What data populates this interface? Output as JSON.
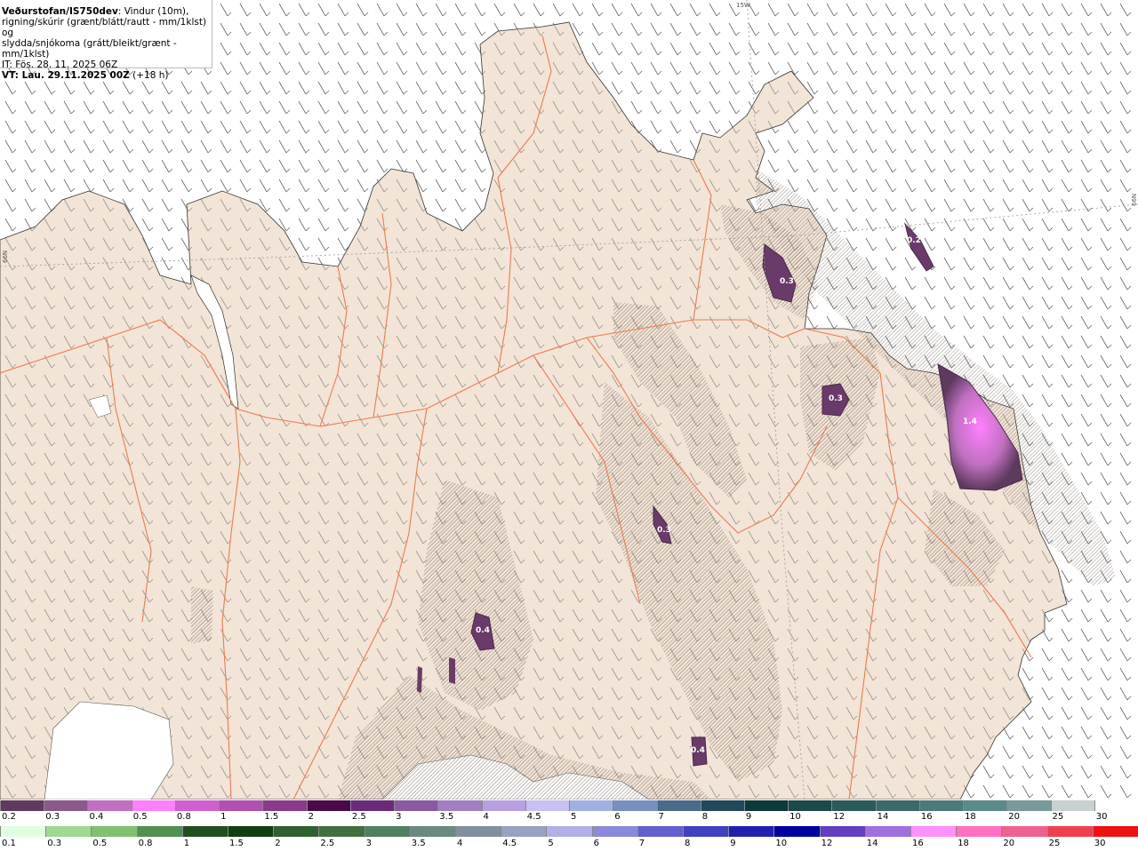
{
  "info": {
    "title_bold": "Veðurstofan/IS750dev",
    "title_rest": ": Vindur (10m),",
    "line2": "rigning/skúrir (grænt/blátt/rautt - mm/1klst) og",
    "line3": "slydda/snjókoma (grátt/bleikt/grænt - mm/1klst)",
    "it": "IT: Fös. 28. 11. 2025 06Z",
    "vt_bold": "VT: Lau. 29.11.2025 00Z",
    "vt_rest": " (+18 h)"
  },
  "grid_labels": {
    "lon_15w": "15W",
    "lat_66n_left": "66N",
    "lat_66n_right": "66N"
  },
  "contour_labels": [
    "0.3",
    "0.3",
    "0.3",
    "1.4",
    "0.4",
    "0.4",
    "0.2"
  ],
  "colors": {
    "land": "#f2e4d6",
    "sea": "#ffffff",
    "roads": "#f07a50",
    "glacier": "#ffffff"
  },
  "legend_snow": {
    "labels": [
      "0.2",
      "0.3",
      "0.4",
      "0.5",
      "0.8",
      "1",
      "1.5",
      "2",
      "2.5",
      "3",
      "3.5",
      "4",
      "4.5",
      "5",
      "6",
      "7",
      "8",
      "9",
      "10",
      "12",
      "14",
      "16",
      "18",
      "20",
      "25",
      "30"
    ],
    "colors": [
      "#5e3a5e",
      "#8b5a8b",
      "#c070c0",
      "#ff80ff",
      "#d060d0",
      "#b050b0",
      "#8a3a8a",
      "#4a0a4a",
      "#6a2a7a",
      "#8a5aa0",
      "#a080c0",
      "#b8a0e0",
      "#c8c0f0",
      "#a0b0e0",
      "#7890c0",
      "#4a6a8a",
      "#204a5a",
      "#0a3a3a",
      "#1a4a4a",
      "#2a5a5a",
      "#3a6a6a",
      "#4a7a7a",
      "#5a8a8a",
      "#7a9a9a",
      "#c8d0d0",
      "#ffffff"
    ]
  },
  "legend_rain": {
    "labels": [
      "0.1",
      "0.3",
      "0.5",
      "0.8",
      "1",
      "1.5",
      "2",
      "2.5",
      "3",
      "3.5",
      "4",
      "4.5",
      "5",
      "6",
      "7",
      "8",
      "9",
      "10",
      "12",
      "14",
      "16",
      "18",
      "20",
      "25",
      "30"
    ],
    "colors": [
      "#e0ffe0",
      "#a0d890",
      "#80c070",
      "#509050",
      "#205020",
      "#104010",
      "#306030",
      "#407040",
      "#508060",
      "#6a8a80",
      "#8090a0",
      "#9aa0c0",
      "#b0b0e8",
      "#8a8ad8",
      "#6060d0",
      "#4040c0",
      "#2020b0",
      "#0000a0",
      "#6040c0",
      "#a070e0",
      "#ff90ff",
      "#ff70c0",
      "#f06090",
      "#f04050",
      "#f01010"
    ]
  }
}
